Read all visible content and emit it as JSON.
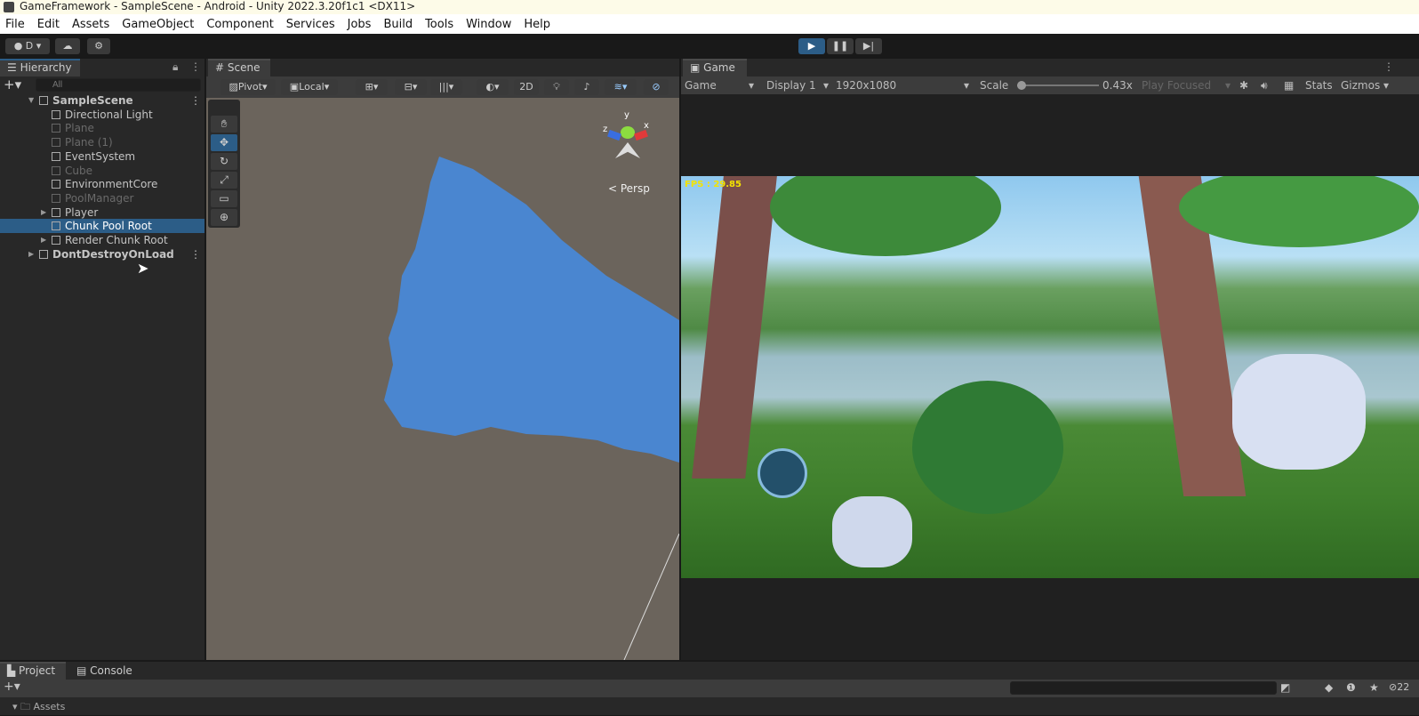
{
  "title": "GameFramework - SampleScene - Android - Unity 2022.3.20f1c1 <DX11>",
  "menu": [
    "File",
    "Edit",
    "Assets",
    "GameObject",
    "Component",
    "Services",
    "Jobs",
    "Build",
    "Tools",
    "Window",
    "Help"
  ],
  "toolbar": {
    "account": "D"
  },
  "hierarchy": {
    "tab": "Hierarchy",
    "search_placeholder": "All",
    "items": [
      {
        "label": "SampleScene",
        "indent": 0,
        "dim": false,
        "scene": true
      },
      {
        "label": "Directional Light",
        "indent": 1,
        "dim": false
      },
      {
        "label": "Plane",
        "indent": 1,
        "dim": true
      },
      {
        "label": "Plane (1)",
        "indent": 1,
        "dim": true
      },
      {
        "label": "EventSystem",
        "indent": 1,
        "dim": false
      },
      {
        "label": "Cube",
        "indent": 1,
        "dim": true
      },
      {
        "label": "EnvironmentCore",
        "indent": 1,
        "dim": false
      },
      {
        "label": "PoolManager",
        "indent": 1,
        "dim": true
      },
      {
        "label": "Player",
        "indent": 1,
        "dim": false,
        "arrow": true
      },
      {
        "label": "Chunk Pool Root",
        "indent": 1,
        "dim": false,
        "selected": true
      },
      {
        "label": "Render Chunk Root",
        "indent": 1,
        "dim": false,
        "arrow": true
      },
      {
        "label": "DontDestroyOnLoad",
        "indent": 0,
        "dim": false,
        "scene": true,
        "arrow": true
      }
    ]
  },
  "scene": {
    "tab": "Scene",
    "pivot": "Pivot",
    "local": "Local",
    "mode2d": "2D",
    "persp": "< Persp",
    "gizmo_axes": [
      "y",
      "x",
      "z"
    ]
  },
  "game": {
    "tab": "Game",
    "view": "Game",
    "display": "Display 1",
    "resolution": "1920x1080",
    "scale_label": "Scale",
    "scale_value": "0.43x",
    "play_mode": "Play Focused",
    "stats": "Stats",
    "gizmos": "Gizmos",
    "fps": "FPS : 29.85",
    "scale_fraction": 0.05
  },
  "bottom": {
    "tabs": [
      "Project",
      "Console"
    ],
    "hidden_count": "22",
    "assets": "Assets"
  },
  "colors": {
    "accent": "#2c5d87",
    "selected": "#2c5d87",
    "scene_bg": "#6b645c",
    "plane": "#4a86d0"
  }
}
